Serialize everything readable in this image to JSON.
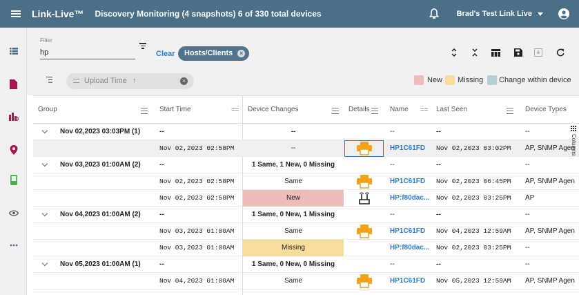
{
  "header": {
    "app_title": "Link-Live™",
    "page_title": "Discovery Monitoring (4 snapshots)  6 of 330 total devices",
    "account": "Brad's Test Link Live",
    "bg_color": "#4a6f87"
  },
  "rail": {
    "items": [
      "list-icon",
      "document-icon",
      "report-chart-icon",
      "location-pin-icon",
      "handheld-device-icon",
      "eye-icon",
      "more-icon"
    ]
  },
  "toolbar": {
    "filter_label": "Filter",
    "filter_value": "hp",
    "clear_label": "Clear",
    "chip_label": "Hosts/Clients"
  },
  "grouping": {
    "chip_label": "Upload Time"
  },
  "legend": [
    {
      "label": "New",
      "color": "#efbcbc"
    },
    {
      "label": "Missing",
      "color": "#f7dc9b"
    },
    {
      "label": "Change within device",
      "color": "#b4cfd7"
    }
  ],
  "columns": [
    "Group",
    "Start Time",
    "Device Changes",
    "Details",
    "Name",
    "Last Seen",
    "Device Types"
  ],
  "columns_tab": "Columns",
  "rows": [
    {
      "type": "group",
      "group": "Nov 02,2023 03:03PM (1)",
      "start": "--",
      "changes": "--",
      "name": "--",
      "last_seen": "--",
      "types": "--"
    },
    {
      "type": "device",
      "start": "Nov 02,2023 02:58PM",
      "changes": "--",
      "change_kind": "",
      "icon": "printer",
      "name": "HP1C61FD",
      "last_seen": "Nov 02,2023 03:02PM",
      "types": "AP, SNMP Agen",
      "selected": true
    },
    {
      "type": "group",
      "group": "Nov 03,2023 01:00AM (2)",
      "start": "--",
      "changes": "1 Same, 1 New, 0 Missing",
      "name": "--",
      "last_seen": "--",
      "types": "--"
    },
    {
      "type": "device",
      "start": "Nov 02,2023 02:58PM",
      "changes": "Same",
      "change_kind": "",
      "icon": "printer",
      "name": "HP1C61FD",
      "last_seen": "Nov 02,2023 06:45PM",
      "types": "AP, SNMP Agen"
    },
    {
      "type": "device",
      "start": "Nov 02,2023 02:58PM",
      "changes": "New",
      "change_kind": "new",
      "icon": "wireless-ap",
      "name": "HP:f80dac...",
      "last_seen": "Nov 02,2023 03:25PM",
      "types": "AP"
    },
    {
      "type": "group",
      "group": "Nov 04,2023 01:00AM (2)",
      "start": "--",
      "changes": "1 Same, 0 New, 1 Missing",
      "name": "--",
      "last_seen": "--",
      "types": "--"
    },
    {
      "type": "device",
      "start": "Nov 03,2023 01:00AM",
      "changes": "Same",
      "change_kind": "",
      "icon": "printer",
      "name": "HP1C61FD",
      "last_seen": "Nov 04,2023 12:59AM",
      "types": "AP, SNMP Agen"
    },
    {
      "type": "device",
      "start": "Nov 03,2023 01:00AM",
      "changes": "Missing",
      "change_kind": "missing",
      "icon": "",
      "name": "HP:f80dac...",
      "last_seen": "Nov 02,2023 03:25PM",
      "types": "--"
    },
    {
      "type": "group",
      "group": "Nov 05,2023 01:00AM (1)",
      "start": "--",
      "changes": "1 Same, 0 New, 0 Missing",
      "name": "--",
      "last_seen": "--",
      "types": "--"
    },
    {
      "type": "device",
      "start": "Nov 04,2023 01:00AM",
      "changes": "Same",
      "change_kind": "",
      "icon": "printer",
      "name": "HP1C61FD",
      "last_seen": "Nov 05,2023 12:59AM",
      "types": "AP, SNMP Agen"
    }
  ]
}
